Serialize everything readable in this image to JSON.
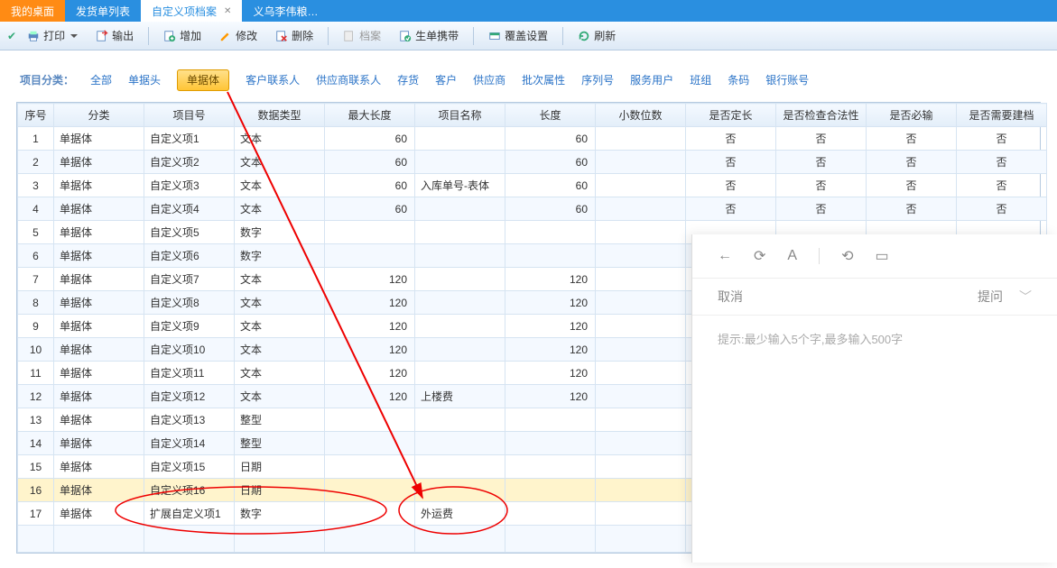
{
  "tabs": [
    {
      "label": "我的桌面"
    },
    {
      "label": "发货单列表"
    },
    {
      "label": "自定义项档案"
    },
    {
      "label": "义乌李伟粮…"
    }
  ],
  "toolbar": {
    "print": "打印",
    "export": "输出",
    "add": "增加",
    "edit": "修改",
    "delete": "删除",
    "archive": "档案",
    "gen": "生单携带",
    "cover": "覆盖设置",
    "refresh": "刷新"
  },
  "filter": {
    "label": "项目分类：",
    "items": [
      "全部",
      "单据头",
      "单据体",
      "客户联系人",
      "供应商联系人",
      "存货",
      "客户",
      "供应商",
      "批次属性",
      "序列号",
      "服务用户",
      "班组",
      "条码",
      "银行账号"
    ],
    "active": "单据体"
  },
  "columns": [
    "序号",
    "分类",
    "项目号",
    "数据类型",
    "最大长度",
    "项目名称",
    "长度",
    "小数位数",
    "是否定长",
    "是否检查合法性",
    "是否必输",
    "是否需要建档"
  ],
  "rows": [
    {
      "seq": 1,
      "cat": "单据体",
      "id": "自定义项1",
      "type": "文本",
      "maxlen": 60,
      "name": "",
      "len": 60,
      "dec": "",
      "fixed": "否",
      "valid": "否",
      "req": "否",
      "arch": "否"
    },
    {
      "seq": 2,
      "cat": "单据体",
      "id": "自定义项2",
      "type": "文本",
      "maxlen": 60,
      "name": "",
      "len": 60,
      "dec": "",
      "fixed": "否",
      "valid": "否",
      "req": "否",
      "arch": "否"
    },
    {
      "seq": 3,
      "cat": "单据体",
      "id": "自定义项3",
      "type": "文本",
      "maxlen": 60,
      "name": "入库单号-表体",
      "len": 60,
      "dec": "",
      "fixed": "否",
      "valid": "否",
      "req": "否",
      "arch": "否"
    },
    {
      "seq": 4,
      "cat": "单据体",
      "id": "自定义项4",
      "type": "文本",
      "maxlen": 60,
      "name": "",
      "len": 60,
      "dec": "",
      "fixed": "否",
      "valid": "否",
      "req": "否",
      "arch": "否"
    },
    {
      "seq": 5,
      "cat": "单据体",
      "id": "自定义项5",
      "type": "数字",
      "maxlen": "",
      "name": "",
      "len": "",
      "dec": "",
      "fixed": "",
      "valid": "",
      "req": "",
      "arch": ""
    },
    {
      "seq": 6,
      "cat": "单据体",
      "id": "自定义项6",
      "type": "数字",
      "maxlen": "",
      "name": "",
      "len": "",
      "dec": "",
      "fixed": "",
      "valid": "",
      "req": "",
      "arch": ""
    },
    {
      "seq": 7,
      "cat": "单据体",
      "id": "自定义项7",
      "type": "文本",
      "maxlen": 120,
      "name": "",
      "len": 120,
      "dec": "",
      "fixed": "",
      "valid": "",
      "req": "",
      "arch": ""
    },
    {
      "seq": 8,
      "cat": "单据体",
      "id": "自定义项8",
      "type": "文本",
      "maxlen": 120,
      "name": "",
      "len": 120,
      "dec": "",
      "fixed": "",
      "valid": "",
      "req": "",
      "arch": ""
    },
    {
      "seq": 9,
      "cat": "单据体",
      "id": "自定义项9",
      "type": "文本",
      "maxlen": 120,
      "name": "",
      "len": 120,
      "dec": "",
      "fixed": "",
      "valid": "",
      "req": "",
      "arch": ""
    },
    {
      "seq": 10,
      "cat": "单据体",
      "id": "自定义项10",
      "type": "文本",
      "maxlen": 120,
      "name": "",
      "len": 120,
      "dec": "",
      "fixed": "",
      "valid": "",
      "req": "",
      "arch": ""
    },
    {
      "seq": 11,
      "cat": "单据体",
      "id": "自定义项11",
      "type": "文本",
      "maxlen": 120,
      "name": "",
      "len": 120,
      "dec": "",
      "fixed": "",
      "valid": "",
      "req": "",
      "arch": ""
    },
    {
      "seq": 12,
      "cat": "单据体",
      "id": "自定义项12",
      "type": "文本",
      "maxlen": 120,
      "name": "上楼费",
      "len": 120,
      "dec": "",
      "fixed": "",
      "valid": "",
      "req": "",
      "arch": ""
    },
    {
      "seq": 13,
      "cat": "单据体",
      "id": "自定义项13",
      "type": "整型",
      "maxlen": "",
      "name": "",
      "len": "",
      "dec": "",
      "fixed": "",
      "valid": "",
      "req": "",
      "arch": ""
    },
    {
      "seq": 14,
      "cat": "单据体",
      "id": "自定义项14",
      "type": "整型",
      "maxlen": "",
      "name": "",
      "len": "",
      "dec": "",
      "fixed": "",
      "valid": "",
      "req": "",
      "arch": ""
    },
    {
      "seq": 15,
      "cat": "单据体",
      "id": "自定义项15",
      "type": "日期",
      "maxlen": "",
      "name": "",
      "len": "",
      "dec": "",
      "fixed": "",
      "valid": "",
      "req": "",
      "arch": ""
    },
    {
      "seq": 16,
      "cat": "单据体",
      "id": "自定义项16",
      "type": "日期",
      "maxlen": "",
      "name": "",
      "len": "",
      "dec": "",
      "fixed": "",
      "valid": "",
      "req": "",
      "arch": ""
    },
    {
      "seq": 17,
      "cat": "单据体",
      "id": "扩展自定义项1",
      "type": "数字",
      "maxlen": "",
      "name": "外运费",
      "len": "",
      "dec": "",
      "fixed": "",
      "valid": "",
      "req": "",
      "arch": ""
    }
  ],
  "panel": {
    "cancel": "取消",
    "ask": "提问",
    "hint": "提示:最少输入5个字,最多输入500字"
  }
}
